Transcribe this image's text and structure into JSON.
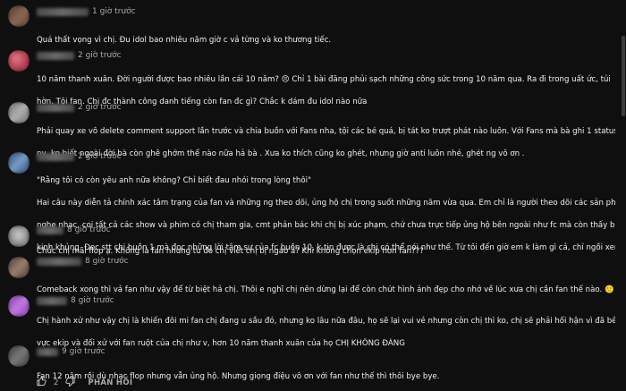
{
  "comments": [
    {
      "time": "1 giờ trước",
      "lines": [
        "Quá thất vọng vì chị. Đu idol bao nhiêu năm giờ c vả từng và ko thương tiếc."
      ],
      "avatar_colors": [
        "#5a3b2e",
        "#8a6a55"
      ]
    },
    {
      "time": "2 giờ trước",
      "lines": [
        "10 năm thanh xuân. Đời người được bao nhiêu lần cái 10 năm? 😣  Chỉ 1 bài đăng phủi sạch những công sức trong 10 năm qua. Ra đi trong uất ức, tủi",
        "hờn. Tội fan. Chị đc thành công danh tiếng còn fan đc gì? Chắc k dám đu idol nào nữa"
      ],
      "avatar_colors": [
        "#b23a4e",
        "#e07a8a"
      ]
    },
    {
      "time": "2 giờ trước",
      "lines": [
        "Phải quay xe vô delete comment support lần trước và chia buồn với Fans nha, tội các bé quá, bị tát ko trượt phát nào luôn.  Với Fans mà bà ghi 1 status",
        "nv, ko biết ngoài đời bà còn ghê ghớm thế nào nữa hả bà .  Xưa ko thích cũng ko ghét, nhưng giờ anti luôn nhé, ghét ng vô ơn ."
      ],
      "avatar_colors": [
        "#6f6f6f",
        "#b0b0b0"
      ]
    },
    {
      "time": "2 giờ trước",
      "lines": [
        "\"Rằng tôi có còn yêu anh nữa không? Chỉ biết đau nhói trong lòng thôi\"",
        "Hai câu này diễn tả chính xác tâm trạng của fan và những ng theo dõi, ủng hộ chị trong suốt những năm vừa qua. Em chỉ là người theo dõi các sản phẩm,",
        "nghe nhạc, coi tất cả các show và phim có chị tham gia, cmt phản bác khi chị bị xúc phạm, chứ chưa trực tiếp ủng hộ bên ngoài như fc mà còn thấy buồn",
        "kinh khủng. Đọc stt chị buồn 1 mà đọc những lời tâm sự của fc buồn 10, k tin được là chị có thể nói như thế. Từ tôi đến giờ em k làm gì cả, chỉ ngồi xem ..."
      ],
      "avatar_colors": [
        "#2c4a7a",
        "#7a9cc6"
      ]
    },
    {
      "time": "8 giờ trước",
      "lines": [
        "Chúc chị mãi flop ạ. Không là fan nhưng tu đó chị viết chị bị ngáo à? Khi không chọn ekip hơn fan???"
      ],
      "avatar_colors": [
        "#8a8a8a",
        "#d0d0d0"
      ]
    },
    {
      "time": "8 giờ trước",
      "lines": [
        "Comeback xong thì vả fan như vậy để từ biệt hả chị. Thôi e nghĩ chị nên dừng lại để còn chút hình ảnh đẹp cho nhớ về lúc xưa chị cần fan thế nào. 🙂"
      ],
      "avatar_colors": [
        "#4a3a30",
        "#9a8070"
      ]
    },
    {
      "time": "8 giờ trước",
      "lines": [
        "Chị hành xử như vậy chị là khiến đôi mi fan chị đang u sầu đó, nhưng ko lâu nữa đâu, họ sẽ lại vui vẻ nhưng còn chị thì ko, chị sẽ phải hối hận vì đã bênh",
        "vực ekip và đối xử với fan ruột của chị như v, hơn 10 năm thanh xuân của họ CHỊ KHÔNG ĐÁNG"
      ],
      "avatar_colors": [
        "#8a3ab0",
        "#c07ae0"
      ]
    },
    {
      "time": "9 giờ trước",
      "lines": [
        "Fan 12 năm rồi dù nhạc flop nhưng vẫn ủng hộ. Nhưng giọng điệu vô ơn với fan như thế thì thôi bye bye."
      ],
      "avatar_colors": [
        "#3a3a3a",
        "#7a7a7a"
      ],
      "likes": "2",
      "reply_label": "PHẢN HỒI"
    }
  ]
}
